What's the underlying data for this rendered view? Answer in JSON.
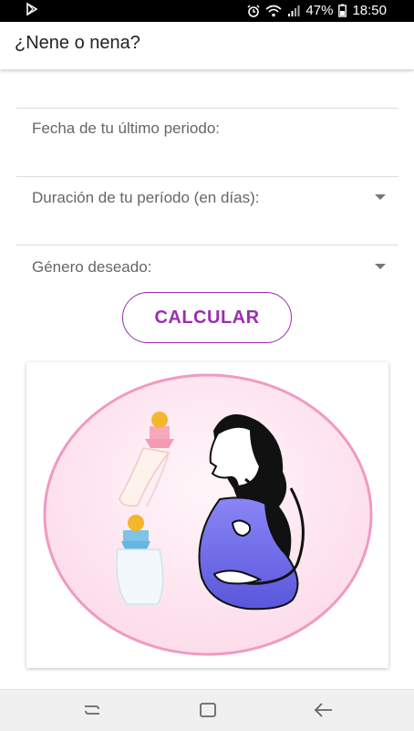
{
  "status_bar": {
    "battery": "47%",
    "time": "18:50",
    "icons": [
      "play-store-icon",
      "alarm-icon",
      "wifi-icon",
      "signal-icon",
      "battery-icon"
    ]
  },
  "app": {
    "title": "¿Nene o nena?"
  },
  "form": {
    "last_period_label": "Fecha de tu último periodo:",
    "duration_label": "Duración de tu período (en días):",
    "gender_label": "Género deseado:"
  },
  "buttons": {
    "calculate": "CALCULAR"
  },
  "colors": {
    "accent": "#9b2fae",
    "circle_fill": "#fde7f1",
    "circle_border": "#ef9ac3",
    "belly": "#6f6ae8"
  },
  "nav": {
    "icons": [
      "recent-apps-icon",
      "home-icon",
      "back-icon"
    ]
  }
}
